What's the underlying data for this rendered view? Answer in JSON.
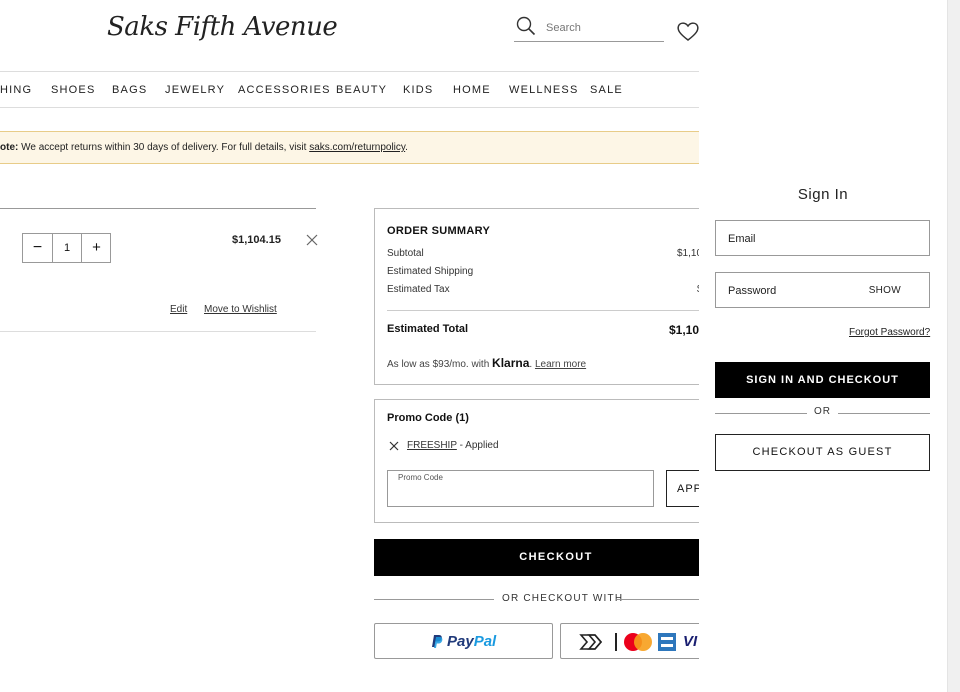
{
  "header": {
    "logo": "Saks Fifth Avenue",
    "search_placeholder": "Search"
  },
  "nav": [
    "HING",
    "SHOES",
    "BAGS",
    "JEWELRY",
    "ACCESSORIES",
    "BEAUTY",
    "KIDS",
    "HOME",
    "WELLNESS",
    "SALE"
  ],
  "notice": {
    "prefix": "ote:",
    "text": " We accept returns within 30 days of delivery. For full details, visit ",
    "link": "saks.com/returnpolicy",
    "suffix": "."
  },
  "cart_item": {
    "quantity": "1",
    "minus": "−",
    "plus": "+",
    "price": "$1,104.15",
    "edit": "Edit",
    "wishlist": "Move to Wishlist"
  },
  "summary": {
    "heading": "ORDER SUMMARY",
    "subtotal_label": "Subtotal",
    "subtotal_value": "$1,10",
    "shipping_label": "Estimated Shipping",
    "tax_label": "Estimated Tax",
    "tax_value": "$",
    "total_label": "Estimated Total",
    "total_value": "$1,10",
    "klarna_prefix": "As low as $93/mo. with ",
    "klarna_brand": "Klarna",
    "klarna_suffix": ".",
    "learn_more": "Learn more"
  },
  "promo": {
    "heading": "Promo Code (1)",
    "code": "FREESHIP",
    "applied": " - Applied",
    "field_label": "Promo Code",
    "apply": "APP"
  },
  "checkout": {
    "button": "CHECKOUT",
    "or_with": "OR CHECKOUT WITH",
    "paypal_a": "Pay",
    "paypal_b": "Pal"
  },
  "signin": {
    "title": "Sign In",
    "email_placeholder": "Email",
    "password_placeholder": "Password",
    "show": "SHOW",
    "forgot": "Forgot Password?",
    "signin_button": "SIGN IN AND CHECKOUT",
    "or": "OR",
    "guest_button": "CHECKOUT AS GUEST"
  },
  "colors": {
    "accent": "#000000",
    "notice_bg": "#fdf6e6",
    "paypal_dark": "#203a7a",
    "paypal_light": "#1a9ae0"
  }
}
